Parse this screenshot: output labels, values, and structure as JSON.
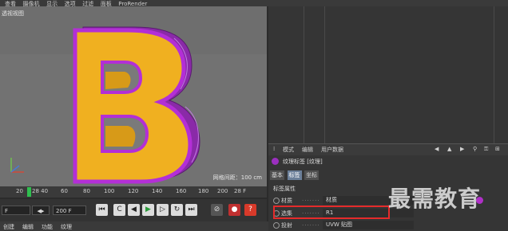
{
  "top_menu": {
    "items": [
      "查看",
      "摄像机",
      "显示",
      "选项",
      "过滤",
      "面板",
      "ProRender"
    ]
  },
  "viewport": {
    "label": "透视视图",
    "grid_spacing_text": "网格间距：100 cm"
  },
  "timeline": {
    "ticks": [
      "20",
      "28 40",
      "60",
      "80",
      "100",
      "120",
      "140",
      "160",
      "180",
      "200"
    ],
    "current_frame": "28 F"
  },
  "transport": {
    "start_field": "F",
    "end_field": "200 F"
  },
  "bottom_menu": {
    "items": [
      "创建",
      "编辑",
      "功能",
      "纹理"
    ]
  },
  "attributes": {
    "toolbar_items": [
      "模式",
      "编辑",
      "用户数据"
    ],
    "tag_title": "纹理标签 [纹理]",
    "tabs": [
      "基本",
      "标签",
      "坐标"
    ],
    "active_tab": "标签",
    "section_title": "标签属性",
    "rows": [
      {
        "label": "材质",
        "value": "材质"
      },
      {
        "label": "选集",
        "value": "R1"
      },
      {
        "label": "投射",
        "value": "UVW 贴图"
      }
    ]
  },
  "watermark": "最需教育",
  "colors": {
    "letter_face": "#f0b020",
    "letter_side": "#9b2fbf",
    "highlight_box": "#e52b2b",
    "timeline_cursor": "#2fbf4f"
  }
}
